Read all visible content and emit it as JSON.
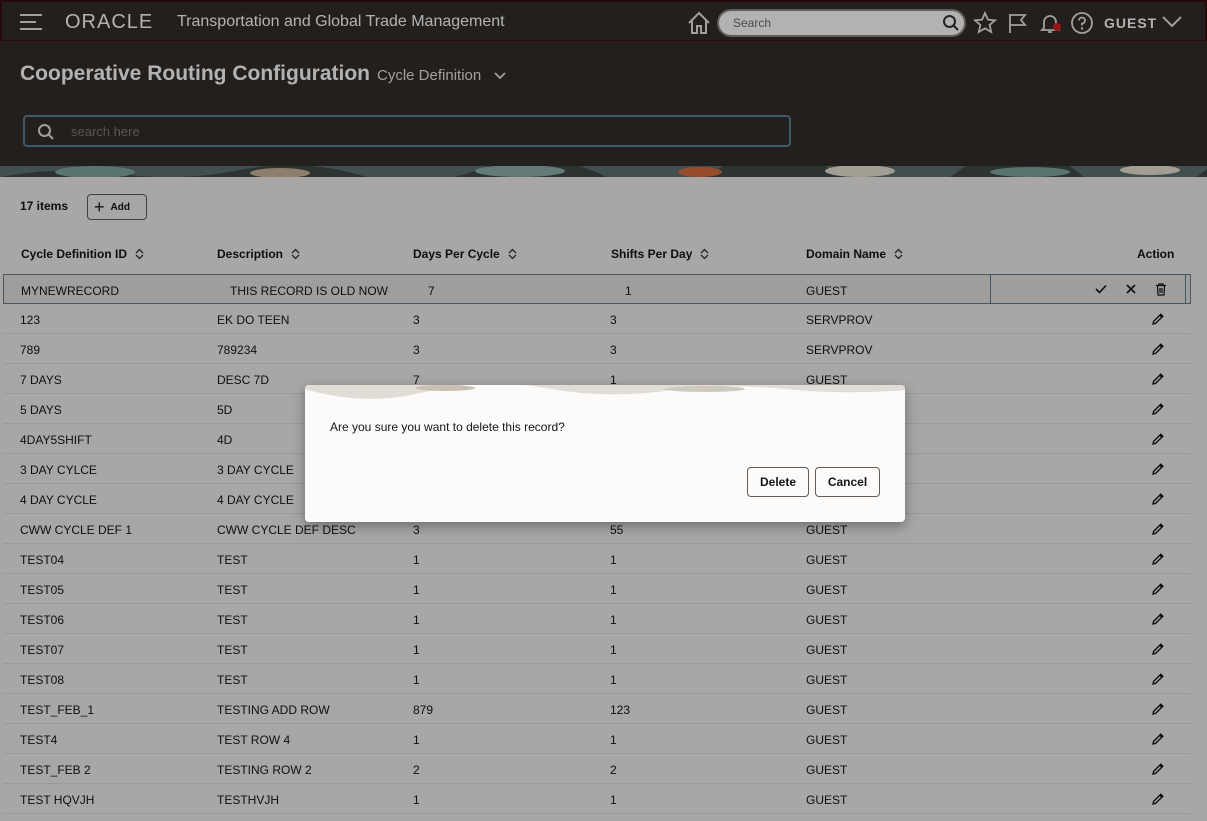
{
  "topbar": {
    "brand": "ORACLE",
    "app_title": "Transportation and Global Trade Management",
    "search_placeholder": "Search",
    "user": "GUEST"
  },
  "header": {
    "page_title": "Cooperative Routing Configuration",
    "subtitle": "Cycle Definition",
    "search_placeholder": "search here"
  },
  "toolbar": {
    "item_count": "17 items",
    "add_label": "Add"
  },
  "table": {
    "columns": [
      "Cycle Definition ID",
      "Description",
      "Days Per Cycle",
      "Shifts Per Day",
      "Domain Name",
      "Action"
    ],
    "edit_row": [
      "MYNEWRECORD",
      "THIS RECORD IS OLD NOW",
      "7",
      "1",
      "GUEST"
    ],
    "rows": [
      [
        "123",
        "EK DO TEEN",
        "3",
        "3",
        "SERVPROV"
      ],
      [
        "789",
        "789234",
        "3",
        "3",
        "SERVPROV"
      ],
      [
        "7 DAYS",
        "DESC 7D",
        "7",
        "1",
        "GUEST"
      ],
      [
        "5 DAYS",
        "5D",
        "",
        "",
        ""
      ],
      [
        "4DAY5SHIFT",
        "4D",
        "",
        "",
        ""
      ],
      [
        "3 DAY CYLCE",
        "3 DAY CYCLE",
        "",
        "",
        ""
      ],
      [
        "4 DAY CYCLE",
        "4 DAY CYCLE",
        "",
        "",
        ""
      ],
      [
        "CWW CYCLE DEF 1",
        "CWW CYCLE DEF DESC",
        "3",
        "55",
        "GUEST"
      ],
      [
        "TEST04",
        "TEST",
        "1",
        "1",
        "GUEST"
      ],
      [
        "TEST05",
        "TEST",
        "1",
        "1",
        "GUEST"
      ],
      [
        "TEST06",
        "TEST",
        "1",
        "1",
        "GUEST"
      ],
      [
        "TEST07",
        "TEST",
        "1",
        "1",
        "GUEST"
      ],
      [
        "TEST08",
        "TEST",
        "1",
        "1",
        "GUEST"
      ],
      [
        "TEST_FEB_1",
        "TESTING ADD ROW",
        "879",
        "123",
        "GUEST"
      ],
      [
        "TEST4",
        "TEST ROW 4",
        "1",
        "1",
        "GUEST"
      ],
      [
        "TEST_FEB 2",
        "TESTING ROW 2",
        "2",
        "2",
        "GUEST"
      ],
      [
        "TEST HQVJH",
        "TESTHVJH",
        "1",
        "1",
        "GUEST"
      ]
    ]
  },
  "dialog": {
    "message": "Are you sure you want to delete this record?",
    "delete_label": "Delete",
    "cancel_label": "Cancel"
  },
  "colors": {
    "header_bg": "#312d2a",
    "content_bg": "#f1efed",
    "accent_border": "#5b7f95"
  }
}
